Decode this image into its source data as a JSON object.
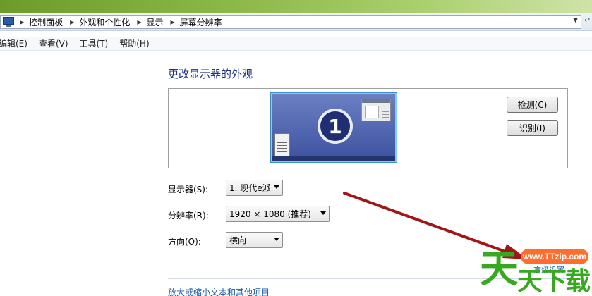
{
  "breadcrumb": [
    "控制面板",
    "外观和个性化",
    "显示",
    "屏幕分辨率"
  ],
  "menu": [
    "编辑(E)",
    "查看(V)",
    "工具(T)",
    "帮助(H)"
  ],
  "page_title": "更改显示器的外观",
  "monitor": {
    "number": "1"
  },
  "buttons": {
    "detect": "检测(C)",
    "identify": "识别(I)"
  },
  "settings": {
    "display": {
      "label": "显示器(S):",
      "value": "1. 现代e派"
    },
    "resolution": {
      "label": "分辨率(R):",
      "value": "1920 × 1080 (推荐)"
    },
    "orientation": {
      "label": "方向(O):",
      "value": "横向"
    }
  },
  "advanced_link": "高级设置",
  "bottom_link": "放大或缩小文本和其他项目",
  "watermark": {
    "site": "www.TTzip.com",
    "big": "天",
    "small": "天下载"
  },
  "colors": {
    "title": "#1e3287",
    "link": "#1e5aa8",
    "arrow": "#a11717",
    "watermark_green": "#38a820",
    "watermark_orange": "#ff6e2e"
  }
}
